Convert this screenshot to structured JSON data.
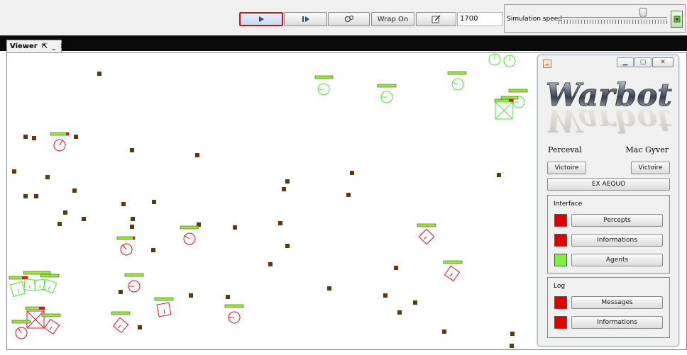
{
  "toolbar": {
    "play_icon": "play-icon",
    "step_icon": "step-forward-icon",
    "settings_icon": "gears-icon",
    "wrap_label": "Wrap On",
    "edit_icon": "edit-icon",
    "tick_count": "1700",
    "speed_label": "Simulation speed",
    "speed_value": 0.78
  },
  "viewer": {
    "tab_label": "Viewer",
    "pin_icon": "pin-icon",
    "minimize_icon": "minimize-icon",
    "close_icon": "close-icon",
    "colors": {
      "resource": "#5c3a0f",
      "green_team": "#55e041",
      "red_team": "#e0141e",
      "health_good": "#9ae642",
      "health_bad": "#e0141e"
    }
  },
  "panel": {
    "logo_text": "Warbot",
    "team_left": "Perceval",
    "team_right": "Mac Gyver",
    "victory_left": "Victoire",
    "victory_right": "Victoire",
    "draw_label": "EX AEQUO",
    "interface": {
      "title": "Interface",
      "items": [
        {
          "label": "Percepts",
          "color": "#e00000"
        },
        {
          "label": "Informations",
          "color": "#e00000"
        },
        {
          "label": "Agents",
          "color": "#7cf040"
        }
      ]
    },
    "log": {
      "title": "Log",
      "items": [
        {
          "label": "Messages",
          "color": "#e00000"
        },
        {
          "label": "Informations",
          "color": "#e00000"
        }
      ]
    }
  }
}
